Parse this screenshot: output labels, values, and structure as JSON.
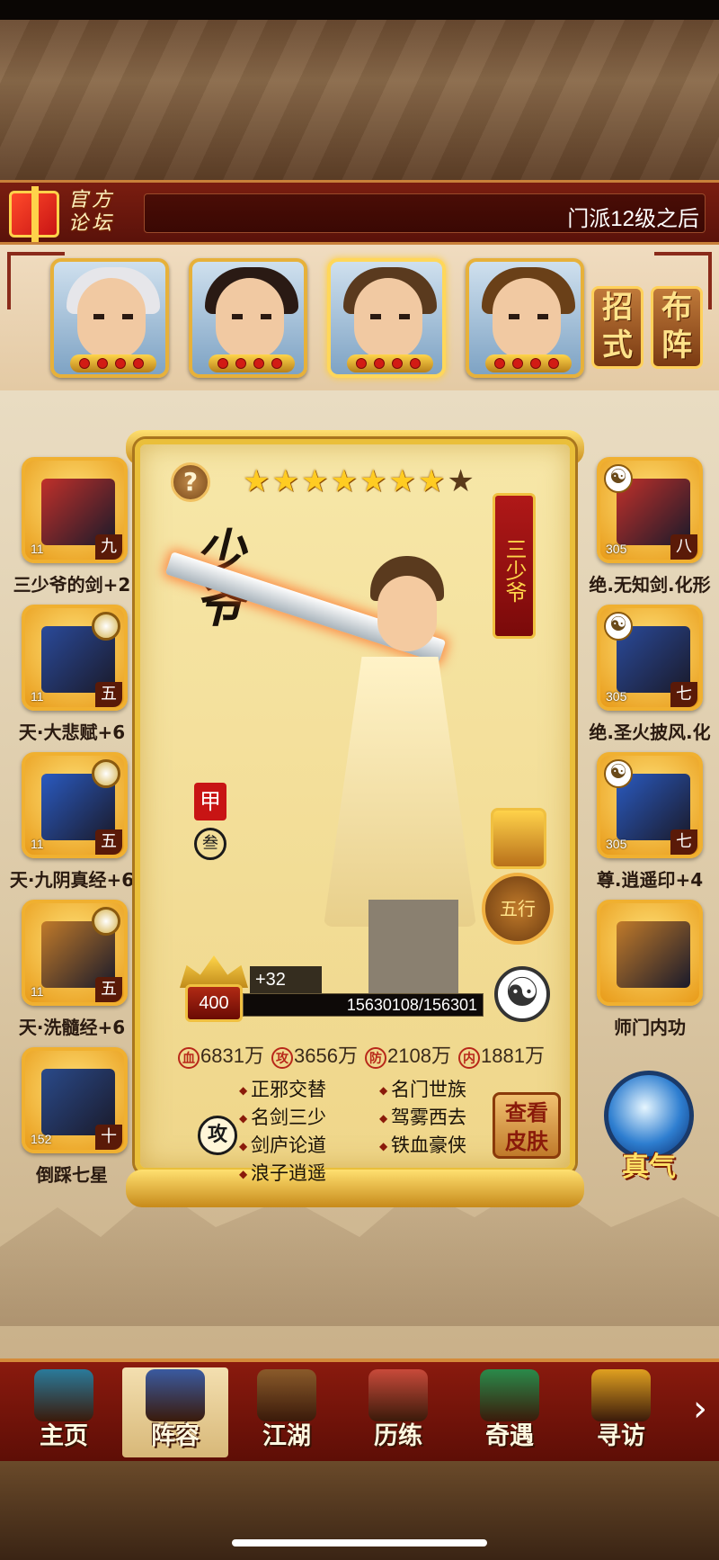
{
  "notice": {
    "forum_label": "官方论坛",
    "marquee": "门派12级之后"
  },
  "heroes": [
    {
      "name": "hero-slot-1",
      "hair": "#e6e6ea"
    },
    {
      "name": "hero-slot-2",
      "hair": "#2a1a14"
    },
    {
      "name": "hero-slot-3",
      "hair": "#5a3a1e"
    },
    {
      "name": "hero-slot-4",
      "hair": "#6a4018"
    }
  ],
  "side_buttons": {
    "moves": "招式",
    "formation": "布阵"
  },
  "left_equipment": [
    {
      "label": "三少爷的剑+2",
      "level": "11",
      "rank": "九"
    },
    {
      "label": "天·大悲赋+6",
      "level": "11",
      "rank": "五"
    },
    {
      "label": "天·九阴真经+6",
      "level": "11",
      "rank": "五"
    },
    {
      "label": "天·洗髓经+6",
      "level": "11",
      "rank": "五"
    },
    {
      "label": "倒踩七星",
      "level": "152",
      "rank": "十"
    }
  ],
  "right_equipment": [
    {
      "label": "绝.无知剑.化形",
      "level": "305",
      "rank": "八"
    },
    {
      "label": "绝.圣火披风.化",
      "level": "305",
      "rank": "七"
    },
    {
      "label": "尊.逍遥印+4",
      "level": "305",
      "rank": "七"
    },
    {
      "label": "师门内功",
      "level": "",
      "rank": ""
    }
  ],
  "card": {
    "help": "?",
    "stars_total": 8,
    "stars_lit": 7,
    "banner": "三少爷",
    "calligraphy": "少爷",
    "seal_jia": "甲",
    "seal_can": "叁",
    "wuxing": "五行",
    "level": "400",
    "exp_gain": "+32",
    "exp_text": "15630108/156301",
    "exp_fraction": 1.0,
    "stats": [
      {
        "icon": "血",
        "value": "6831万"
      },
      {
        "icon": "攻",
        "value": "3656万"
      },
      {
        "icon": "防",
        "value": "2108万"
      },
      {
        "icon": "内",
        "value": "1881万"
      }
    ],
    "attack_icon": "攻",
    "traits_left": [
      "正邪交替",
      "名剑三少",
      "剑庐论道",
      "浪子逍遥"
    ],
    "traits_right": [
      "名门世族",
      "驾雾西去",
      "铁血豪侠"
    ],
    "skin_button": "查看皮肤"
  },
  "qi": {
    "label": "真气"
  },
  "nav": [
    {
      "label": "主页",
      "color": "#2a7a9a"
    },
    {
      "label": "阵容",
      "color": "#3a5aa0"
    },
    {
      "label": "江湖",
      "color": "#8a5a2a"
    },
    {
      "label": "历练",
      "color": "#c84a3a"
    },
    {
      "label": "奇遇",
      "color": "#2a8a4a"
    },
    {
      "label": "寻访",
      "color": "#e0a020"
    }
  ],
  "nav_active": 1,
  "nav_more": "›"
}
